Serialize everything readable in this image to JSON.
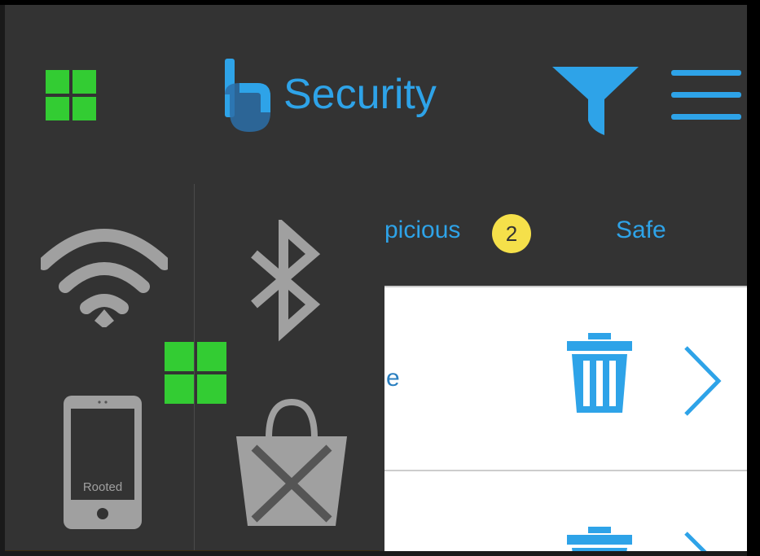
{
  "header": {
    "app_name": "Security",
    "logo_icon": "bu-logo-icon",
    "left_icon": "windows-icon",
    "filter_icon": "filter-funnel-icon",
    "menu_icon": "hamburger-menu-icon"
  },
  "tabs": {
    "suspicious_label": "picious",
    "suspicious_count": "2",
    "safe_label": "Safe"
  },
  "list": {
    "rows": [
      {
        "text": "e",
        "delete_icon": "trash-icon",
        "open_icon": "chevron-right-icon"
      }
    ]
  },
  "overlay": {
    "rooted_label": "Rooted",
    "tiles": [
      "wifi-icon",
      "bluetooth-icon",
      "rooted-phone-icon",
      "blocked-store-bag-icon",
      "windows-icon"
    ]
  },
  "colors": {
    "accent_blue": "#2ea3e8",
    "header_bg": "#333333",
    "icon_gray": "#a0a0a0",
    "windows_green": "#33cc33",
    "badge_yellow": "#f5e04a"
  }
}
